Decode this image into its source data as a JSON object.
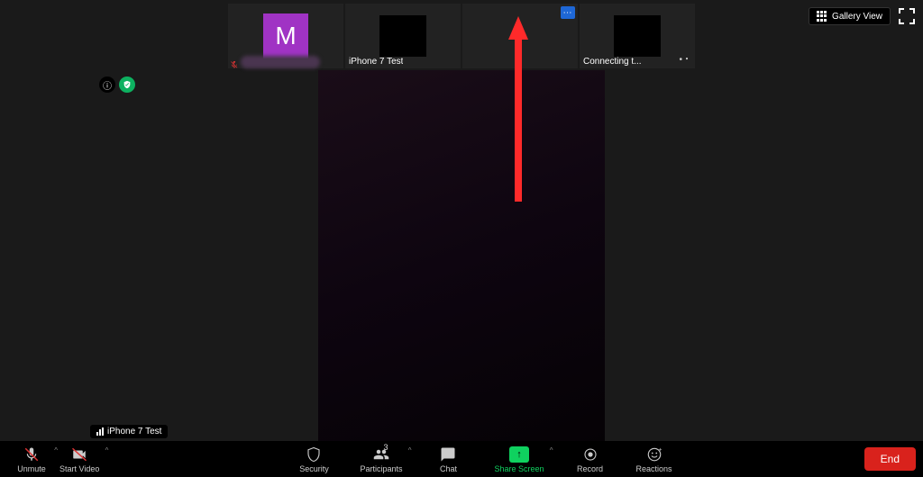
{
  "view_controls": {
    "gallery_label": "Gallery View"
  },
  "participants_strip": [
    {
      "avatar_letter": "M",
      "muted": true,
      "name_redacted": true
    },
    {
      "label": "iPhone 7 Test"
    },
    {
      "show_menu": true
    },
    {
      "label": "Connecting t...",
      "show_dots": true
    }
  ],
  "audio_indicator": {
    "label": "iPhone 7 Test"
  },
  "toolbar": {
    "unmute": "Unmute",
    "start_video": "Start Video",
    "security": "Security",
    "participants": "Participants",
    "participants_count": "3",
    "chat": "Chat",
    "share_screen": "Share Screen",
    "record": "Record",
    "reactions": "Reactions",
    "end": "End"
  }
}
